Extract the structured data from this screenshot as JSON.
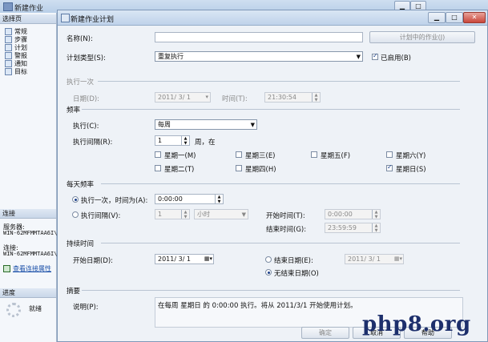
{
  "back_window": {
    "title": "新建作业"
  },
  "left_panel": {
    "select_page_header": "选择页",
    "nav": [
      {
        "label": "常规",
        "icon": "page-icon"
      },
      {
        "label": "步骤",
        "icon": "page-icon"
      },
      {
        "label": "计划",
        "icon": "page-icon"
      },
      {
        "label": "警报",
        "icon": "page-icon"
      },
      {
        "label": "通知",
        "icon": "page-icon"
      },
      {
        "label": "目标",
        "icon": "page-icon"
      }
    ],
    "connection_header": "连接",
    "server_label": "服务器:",
    "server_value": "WIN-62MFMMTAA6I\\",
    "connection_label": "连接:",
    "connection_value": "WIN-62MFMMTAA6I\\",
    "view_conn_props": "查看连接属性",
    "progress_header": "进度",
    "progress_status": "就绪"
  },
  "dialog": {
    "title": "新建作业计划",
    "name_label": "名称(N):",
    "name_value": "",
    "jobs_in_schedule_btn": "计划中的作业(J)",
    "schedule_type_label": "计划类型(S):",
    "schedule_type_value": "重复执行",
    "enabled_label": "已启用(B)",
    "one_time": {
      "header": "执行一次",
      "date_label": "日期(D):",
      "date_value": "2011/ 3/ 1",
      "time_label": "时间(T):",
      "time_value": "21:30:54"
    },
    "frequency": {
      "header": "频率",
      "occurs_label": "执行(C):",
      "occurs_value": "每周",
      "recurs_label": "执行间隔(R):",
      "recurs_value": "1",
      "recurs_suffix": "周，在",
      "days": [
        {
          "label": "星期一(M)",
          "checked": false
        },
        {
          "label": "星期三(E)",
          "checked": false
        },
        {
          "label": "星期五(F)",
          "checked": false
        },
        {
          "label": "星期六(Y)",
          "checked": false
        },
        {
          "label": "星期二(T)",
          "checked": false
        },
        {
          "label": "星期四(H)",
          "checked": false
        },
        {
          "label": "星期日(S)",
          "checked": true
        }
      ]
    },
    "daily": {
      "header": "每天频率",
      "once_label": "执行一次，时间为(A):",
      "once_value": "0:00:00",
      "every_label": "执行间隔(V):",
      "every_value": "1",
      "every_unit": "小时",
      "start_label": "开始时间(T):",
      "start_value": "0:00:00",
      "end_label": "结束时间(G):",
      "end_value": "23:59:59"
    },
    "duration": {
      "header": "持续时间",
      "start_date_label": "开始日期(D):",
      "start_date_value": "2011/ 3/ 1",
      "end_date_label": "结束日期(E):",
      "end_date_value": "2011/ 3/ 1",
      "no_end_label": "无结束日期(O)"
    },
    "summary": {
      "header": "摘要",
      "desc_label": "说明(P):",
      "desc_value": "在每周 星期日 的 0:00:00 执行。将从 2011/3/1 开始使用计划。"
    },
    "ok_btn": "确定",
    "cancel_btn": "取消",
    "help_btn": "帮助"
  },
  "watermark": "php8.org"
}
